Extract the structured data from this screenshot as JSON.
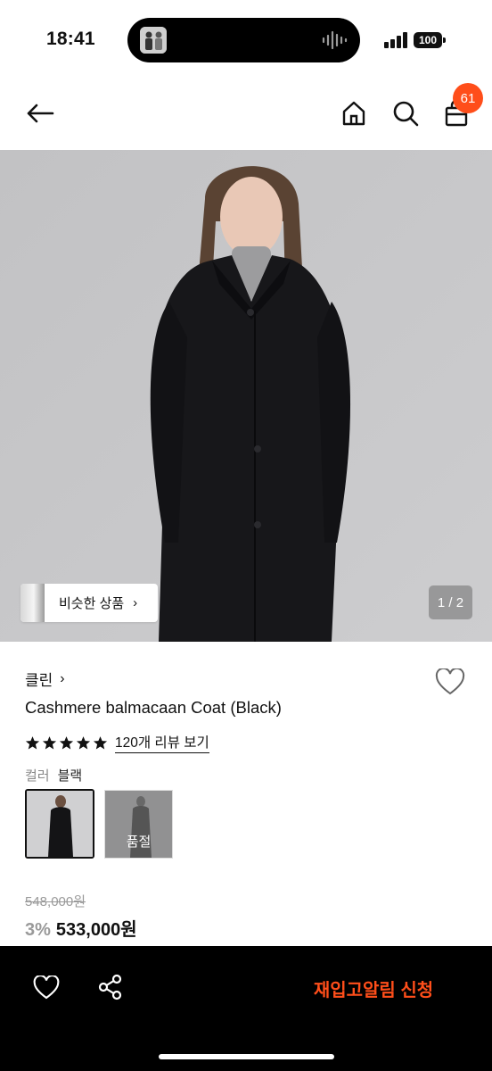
{
  "status": {
    "time": "18:41",
    "battery": "100"
  },
  "header": {
    "cart_count": "61"
  },
  "hero": {
    "similar_label": "비슷한 상품",
    "pager": "1 / 2"
  },
  "product": {
    "brand": "클린",
    "title": "Cashmere balmacaan Coat (Black)",
    "rating": 5,
    "reviews_label": "120개 리뷰 보기",
    "color_key": "컬러",
    "color_value": "블랙",
    "swatches": [
      {
        "name": "블랙",
        "selected": true
      },
      {
        "name": "",
        "badge": "품절"
      }
    ],
    "original_price": "548,000원",
    "discount": "3%",
    "price": "533,000원"
  },
  "bottom": {
    "restock_label": "재입고알림 신청"
  },
  "colors": {
    "accent": "#ff4e1a",
    "bar_bg": "#000000"
  }
}
